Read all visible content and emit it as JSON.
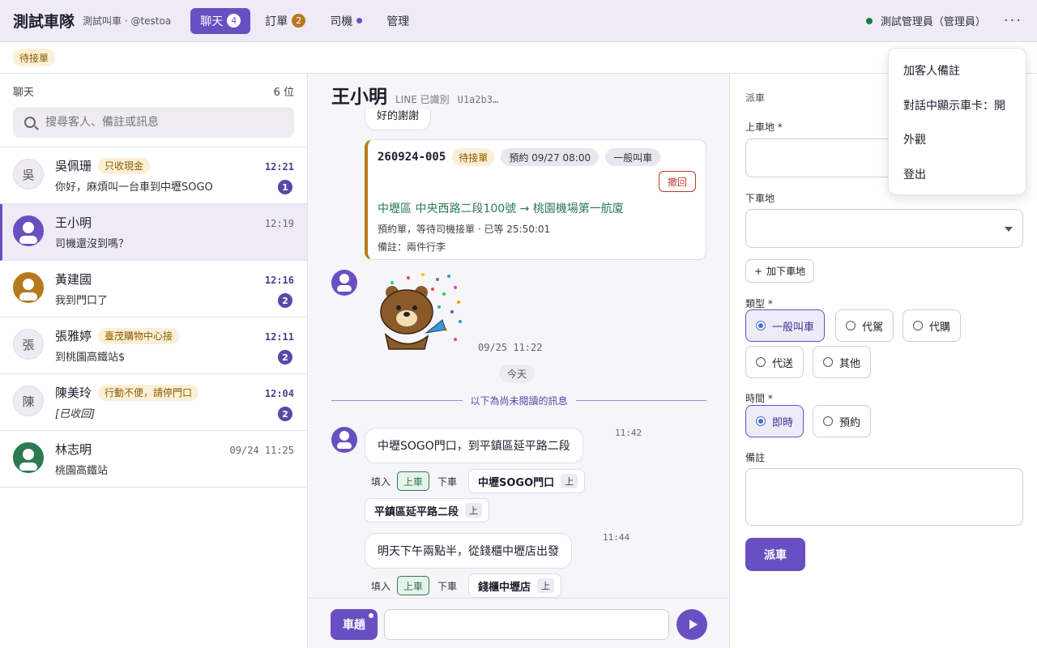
{
  "topbar": {
    "brand": "測試車隊",
    "brand_sub": "測試叫車 · @testoa",
    "tabs": [
      {
        "label": "聊天",
        "badge": "4"
      },
      {
        "label": "訂單",
        "badge": "2"
      },
      {
        "label": "司機"
      },
      {
        "label": "管理"
      }
    ],
    "user": "測試管理員（管理員）",
    "more": "···"
  },
  "subbar": {
    "filter_chip": "待接單"
  },
  "left": {
    "title": "聊天",
    "count": "6 位",
    "search_placeholder": "搜尋客人、備註或訊息",
    "conversations": [
      {
        "avatar": "吳",
        "name": "吳佩珊",
        "tag": "只收現金",
        "preview": "你好，麻煩叫一台車到中壢SOGO",
        "time": "12:21",
        "badge": "1"
      },
      {
        "name": "王小明",
        "preview": "司機還沒到嗎？",
        "time": "12:19"
      },
      {
        "name": "黃建國",
        "preview": "我到門口了",
        "time": "12:16",
        "badge": "2"
      },
      {
        "avatar": "張",
        "name": "張雅婷",
        "tag": "臺茂購物中心接",
        "preview": "到桃園高鐵站$",
        "time": "12:11",
        "badge": "2"
      },
      {
        "avatar": "陳",
        "name": "陳美玲",
        "tag": "行動不便，請停門口",
        "preview": "[已收回]",
        "time": "12:04",
        "badge": "2"
      },
      {
        "name": "林志明",
        "preview": "桃園高鐵站",
        "time": "09/24 11:25"
      }
    ]
  },
  "chat": {
    "name": "王小明",
    "line_status": "LINE 已識別",
    "uid": "U1a2b3…",
    "prev_bubble": "好的謝謝",
    "order": {
      "id": "260924-005",
      "status": "待接單",
      "schedule": "預約 09/27 08:00",
      "type": "一般叫車",
      "revoke": "撤回",
      "route": "中壢區 中央西路二段100號 → 桃園機場第一航廈",
      "status_text": "預約單，等待司機接單 · 已等 25:50:01",
      "note": "備註：兩件行李"
    },
    "sticker_time": "09/25 11:22",
    "day_separator": "今天",
    "unread_divider": "以下為尚未閱讀的訊息",
    "messages": [
      {
        "text": "中壢SOGO門口，到平鎮區延平路二段",
        "time": "11:42",
        "fill_label": "填入",
        "pickup": "上車",
        "dropoff": "下車",
        "locations": [
          "中壢SOGO門口",
          "平鎮區延平路二段"
        ],
        "loc_tag": "上"
      },
      {
        "text": "明天下午兩點半，從錢櫃中壢店出發",
        "time": "11:44",
        "fill_label": "填入",
        "pickup": "上車",
        "dropoff": "下車",
        "locations": [
          "錢櫃中壢店"
        ],
        "loc_tag": "上"
      }
    ],
    "car_button": "車趟",
    "input_placeholder": ""
  },
  "dispatch": {
    "title": "派車",
    "pickup_label": "上車地 *",
    "dropoff_label": "下車地",
    "add_dropoff": "加下車地",
    "type_label": "類型 *",
    "types": [
      "一般叫車",
      "代駕",
      "代購",
      "代送",
      "其他"
    ],
    "time_label": "時間 *",
    "times": [
      "即時",
      "預約"
    ],
    "note_label": "備註",
    "submit": "派車"
  },
  "menu": {
    "items": [
      "加客人備註",
      "對話中顯示車卡：開",
      "外觀",
      "登出"
    ]
  },
  "colors": {
    "accent": "#6a4fc2",
    "warning": "#b7791f",
    "success": "#2d7a50",
    "danger": "#c0392b"
  }
}
